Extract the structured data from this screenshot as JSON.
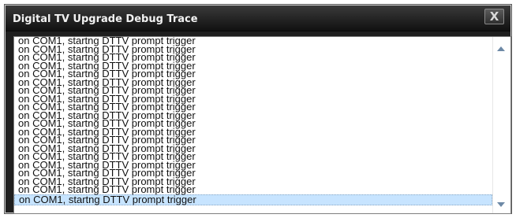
{
  "window": {
    "title": "Digital TV Upgrade Debug Trace",
    "close_symbol": "X"
  },
  "log": {
    "lines": [
      "on COM1, startng DTTV prompt trigger",
      "on COM1, startng DTTV prompt trigger",
      "on COM1, startng DTTV prompt trigger",
      "on COM1, startng DTTV prompt trigger",
      "on COM1, startng DTTV prompt trigger",
      "on COM1, startng DTTV prompt trigger",
      "on COM1, startng DTTV prompt trigger",
      "on COM1, startng DTTV prompt trigger",
      "on COM1, startng DTTV prompt trigger",
      "on COM1, startng DTTV prompt trigger",
      "on COM1, startng DTTV prompt trigger",
      "on COM1, startng DTTV prompt trigger",
      "on COM1, startng DTTV prompt trigger",
      "on COM1, startng DTTV prompt trigger",
      "on COM1, startng DTTV prompt trigger",
      "on COM1, startng DTTV prompt trigger",
      "on COM1, startng DTTV prompt trigger",
      "on COM1, startng DTTV prompt trigger",
      "on COM1, startng DTTV prompt trigger",
      "on COM1, startng DTTV prompt trigger"
    ],
    "selected_line": 19
  },
  "icons": {
    "close": "close-icon",
    "scroll_up": "scroll-up-arrow-icon",
    "scroll_down": "scroll-down-arrow-icon"
  }
}
